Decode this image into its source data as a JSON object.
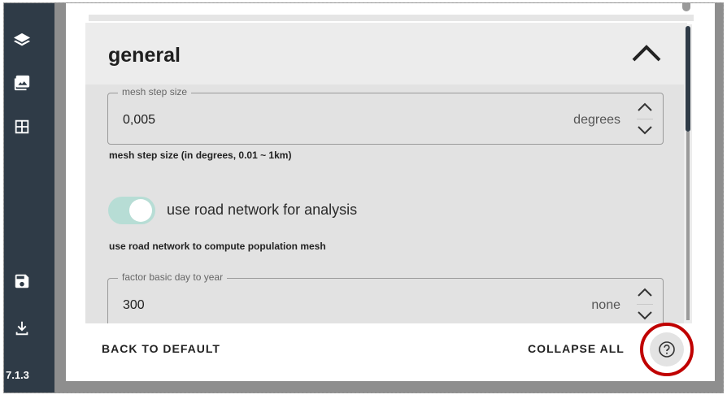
{
  "sidebar": {
    "icons": [
      "layers-icon",
      "gallery-icon",
      "table-icon",
      "save-icon",
      "download-icon"
    ],
    "version": "7.1.3"
  },
  "panel": {
    "title": "general"
  },
  "fields": {
    "mesh_step": {
      "label": "mesh step size",
      "value": "0,005",
      "unit": "degrees",
      "hint": "mesh step size (in degrees, 0.01 ~ 1km)"
    },
    "road_network": {
      "label": "use road network for analysis",
      "checked": true,
      "hint": "use road network to compute population mesh"
    },
    "factor": {
      "label": "factor basic day to year",
      "value": "300",
      "unit": "none"
    }
  },
  "footer": {
    "back_to_default": "BACK TO DEFAULT",
    "collapse_all": "COLLAPSE ALL"
  },
  "colors": {
    "sidebar": "#2f3b47",
    "toggle_track": "#b7ddd5",
    "highlight_ring": "#c00000"
  }
}
